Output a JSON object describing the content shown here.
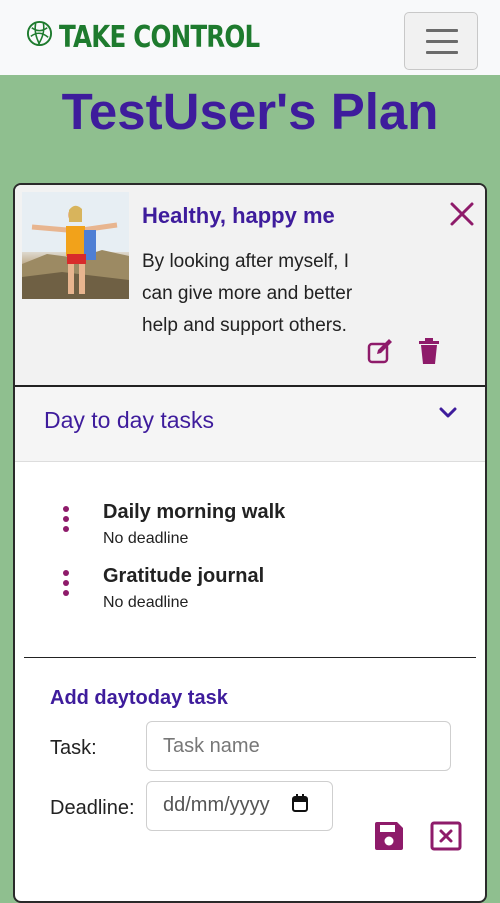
{
  "navbar": {
    "brand": "TAKE CONTROL",
    "toggler_icon": "hamburger-menu-icon"
  },
  "page": {
    "title": "TestUser's Plan"
  },
  "goal": {
    "title": "Healthy, happy me",
    "description": "By looking after myself, I can give more and better help and support others.",
    "icons": {
      "close": "close-x-icon",
      "edit": "edit-square-icon",
      "delete": "trash-icon"
    }
  },
  "accordion": {
    "title": "Day to day tasks",
    "icon": "chevron-down-icon"
  },
  "tasks": [
    {
      "name": "Daily morning walk",
      "deadline": "No deadline"
    },
    {
      "name": "Gratitude journal",
      "deadline": "No deadline"
    }
  ],
  "add_form": {
    "title": "Add daytoday task",
    "task_label": "Task:",
    "task_placeholder": "Task name",
    "deadline_label": "Deadline:",
    "deadline_placeholder": "dd/mm/yyyy",
    "icons": {
      "save": "floppy-disk-icon",
      "cancel": "square-x-icon"
    }
  },
  "colors": {
    "brand": "#1e7b2e",
    "accent": "#3e1c9c",
    "icon": "#8e1b6a",
    "background": "#8fbf8f"
  }
}
